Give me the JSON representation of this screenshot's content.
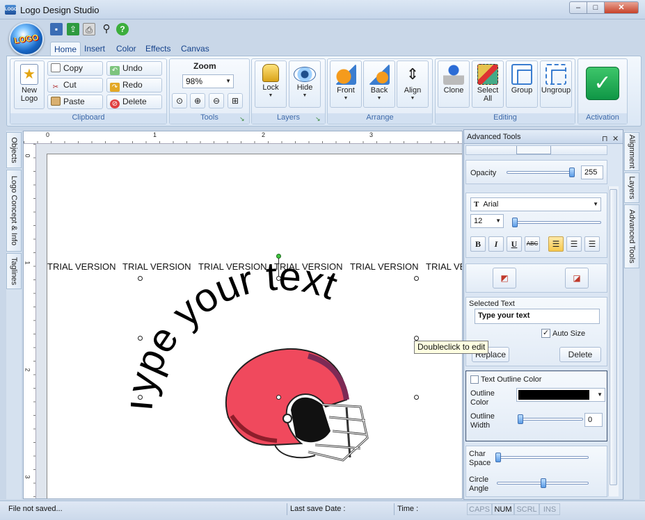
{
  "window": {
    "title": "Logo Design Studio",
    "min_glyph": "‒",
    "max_glyph": "□",
    "close_glyph": "✕",
    "icon_text": "LOGO"
  },
  "orb": {
    "text": "LOGO"
  },
  "ribbon_tabs": [
    "Home",
    "Insert",
    "Color",
    "Effects",
    "Canvas"
  ],
  "clipboard": {
    "new_logo": "New\nLogo",
    "copy": "Copy",
    "undo": "Undo",
    "cut": "Cut",
    "redo": "Redo",
    "paste": "Paste",
    "delete": "Delete",
    "group_label": "Clipboard"
  },
  "tools": {
    "zoom_label": "Zoom",
    "zoom_value": "98%",
    "group_label": "Tools"
  },
  "layers": {
    "lock": "Lock",
    "hide": "Hide",
    "group_label": "Layers"
  },
  "arrange": {
    "front": "Front",
    "back": "Back",
    "align": "Align",
    "group_label": "Arrange"
  },
  "editing": {
    "clone": "Clone",
    "select_all": "Select\nAll",
    "group": "Group",
    "ungroup": "Ungroup",
    "group_label": "Editing"
  },
  "activation": {
    "group_label": "Activation"
  },
  "left_tabs": [
    "Objects",
    "Logo Concept & Info",
    "Taglines"
  ],
  "right_tabs": [
    "Alignment",
    "Layers",
    "Advanced Tools"
  ],
  "rulers": {
    "top": [
      "0",
      "1",
      "2",
      "3"
    ],
    "left": [
      "0",
      "1",
      "2",
      "3"
    ]
  },
  "canvas": {
    "trial": [
      "TRIAL VERSION",
      "TRIAL VERSION",
      "TRIAL VERSION",
      "TRIAL VERSION",
      "TRIAL VERSION",
      "TRIAL VE"
    ],
    "curved_text": "Type your text",
    "tooltip": "Doubleclick to edit",
    "helmet_color": "#f0495d"
  },
  "panel": {
    "title": "Advanced Tools",
    "pin_glyph": "⊓",
    "close_glyph": "✕",
    "opacity_label": "Opacity",
    "opacity_value": "255",
    "opacity_level": 1.0,
    "font_name": "Arial",
    "font_size": "12",
    "format_buttons": [
      "B",
      "I",
      "U",
      "ABC"
    ],
    "selected_text_label": "Selected Text",
    "selected_text_value": "Type your text",
    "auto_size_label": "Auto Size",
    "auto_size_checked": true,
    "replace_label": "Replace",
    "delete_label": "Delete",
    "outline_color_label": "Text Outline Color",
    "outline_color_field": "Outline\nColor",
    "outline_color_value": "#000000",
    "outline_width_field": "Outline\nWidth",
    "outline_width_value": "0",
    "char_space_label": "Char\nSpace",
    "circle_angle_label": "Circle\nAngle",
    "circle_angle_level": 0.5
  },
  "status": {
    "file": "File not saved...",
    "last_save": "Last save Date :",
    "time": "Time :",
    "caps": "CAPS",
    "num": "NUM",
    "scrl": "SCRL",
    "ins": "INS"
  }
}
